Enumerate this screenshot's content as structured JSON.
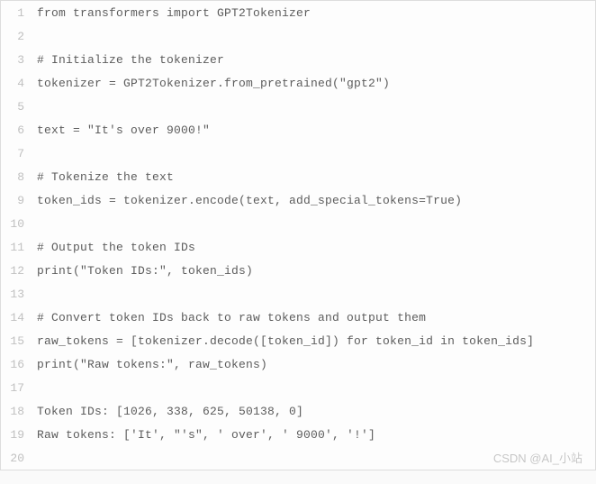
{
  "code_lines": [
    "from transformers import GPT2Tokenizer",
    "",
    "# Initialize the tokenizer",
    "tokenizer = GPT2Tokenizer.from_pretrained(\"gpt2\")",
    "",
    "text = \"It's over 9000!\"",
    "",
    "# Tokenize the text",
    "token_ids = tokenizer.encode(text, add_special_tokens=True)",
    "",
    "# Output the token IDs",
    "print(\"Token IDs:\", token_ids)",
    "",
    "# Convert token IDs back to raw tokens and output them",
    "raw_tokens = [tokenizer.decode([token_id]) for token_id in token_ids]",
    "print(\"Raw tokens:\", raw_tokens)",
    "",
    "Token IDs: [1026, 338, 625, 50138, 0]",
    "Raw tokens: ['It', \"'s\", ' over', ' 9000', '!']",
    ""
  ],
  "watermark": "CSDN @AI_小站"
}
